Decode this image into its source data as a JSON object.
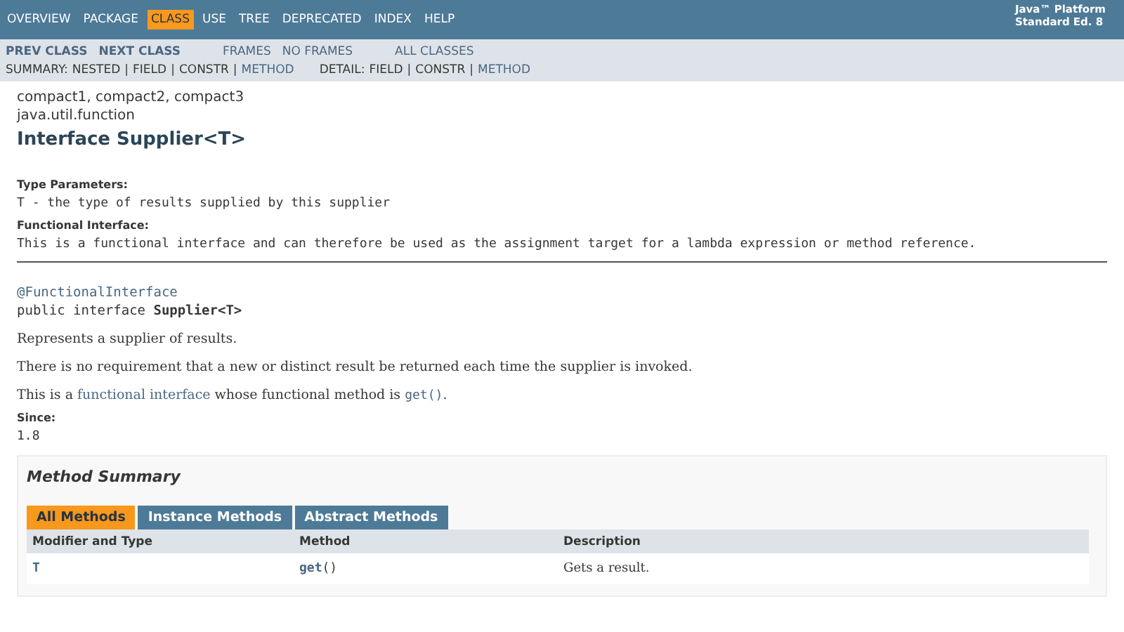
{
  "top_nav": {
    "items": [
      {
        "label": "OVERVIEW",
        "selected": false
      },
      {
        "label": "PACKAGE",
        "selected": false
      },
      {
        "label": "CLASS",
        "selected": true
      },
      {
        "label": "USE",
        "selected": false
      },
      {
        "label": "TREE",
        "selected": false
      },
      {
        "label": "DEPRECATED",
        "selected": false
      },
      {
        "label": "INDEX",
        "selected": false
      },
      {
        "label": "HELP",
        "selected": false
      }
    ],
    "platform": [
      "Java™ Platform",
      "Standard Ed. 8"
    ]
  },
  "sub_nav": {
    "prev_next": [
      "PREV CLASS",
      "NEXT CLASS"
    ],
    "frames": [
      "FRAMES",
      "NO FRAMES"
    ],
    "all_classes": "ALL CLASSES"
  },
  "summary_nav": {
    "separator": "|",
    "summary_label": "SUMMARY:",
    "summary": [
      {
        "label": "NESTED",
        "linked": false
      },
      {
        "label": "FIELD",
        "linked": false
      },
      {
        "label": "CONSTR",
        "linked": false
      },
      {
        "label": "METHOD",
        "linked": true
      }
    ],
    "detail_label": "DETAIL:",
    "detail": [
      {
        "label": "FIELD",
        "linked": false
      },
      {
        "label": "CONSTR",
        "linked": false
      },
      {
        "label": "METHOD",
        "linked": true
      }
    ]
  },
  "header": {
    "profiles": "compact1, compact2, compact3",
    "package": "java.util.function",
    "title": "Interface Supplier<T>"
  },
  "type_parameters": {
    "label": "Type Parameters:",
    "text": "T - the type of results supplied by this supplier"
  },
  "functional_interface": {
    "label": "Functional Interface:",
    "text": "This is a functional interface and can therefore be used as the assignment target for a lambda expression or method reference."
  },
  "declaration": {
    "annotation": "@FunctionalInterface",
    "prefix": "public interface ",
    "name": "Supplier<T>"
  },
  "description": [
    "Represents a supplier of results.",
    "There is no requirement that a new or distinct result be returned each time the supplier is invoked."
  ],
  "note": [
    {
      "text": "This is a ",
      "kind": "plain"
    },
    {
      "text": "functional interface",
      "kind": "link"
    },
    {
      "text": " whose functional method is ",
      "kind": "plain"
    },
    {
      "text": "get()",
      "kind": "code-link"
    },
    {
      "text": ".",
      "kind": "plain"
    }
  ],
  "since": {
    "label": "Since:",
    "value": "1.8"
  },
  "method_summary": {
    "title": "Method Summary",
    "tabs": [
      {
        "label": "All Methods",
        "selected": true
      },
      {
        "label": "Instance Methods",
        "selected": false
      },
      {
        "label": "Abstract Methods",
        "selected": false
      }
    ],
    "columns": [
      "Modifier and Type",
      "Method",
      "Description"
    ],
    "rows": [
      {
        "type": "T",
        "method": "get",
        "params": "()",
        "description": "Gets a result."
      }
    ]
  }
}
